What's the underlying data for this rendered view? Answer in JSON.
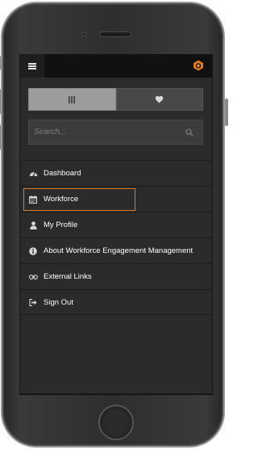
{
  "colors": {
    "accent": "#e07a22",
    "topbar": "#111111",
    "drawer_bg": "#2b2b2b",
    "toggle_active": "#9c9c9c",
    "toggle_inactive": "#484848",
    "text": "#ffffff"
  },
  "header": {
    "menu_icon": "hamburger-menu-icon",
    "logo_icon": "orange-hexagon-logo"
  },
  "toggle": {
    "segments": [
      {
        "icon": "grid-columns-icon",
        "selected": true
      },
      {
        "icon": "heart-icon",
        "selected": false
      }
    ]
  },
  "search": {
    "placeholder": "Search...",
    "value": "",
    "icon": "search-icon"
  },
  "menu": {
    "items": [
      {
        "label": "Dashboard",
        "icon": "dashboard-gauge-icon",
        "active": false
      },
      {
        "label": "Workforce",
        "icon": "calendar-icon",
        "active": true
      },
      {
        "label": "My Profile",
        "icon": "user-icon",
        "active": false
      },
      {
        "label": "About Workforce Engagement Management",
        "icon": "info-icon",
        "active": false
      },
      {
        "label": "External Links",
        "icon": "link-icon",
        "active": false
      },
      {
        "label": "Sign Out",
        "icon": "sign-out-icon",
        "active": false
      }
    ]
  }
}
